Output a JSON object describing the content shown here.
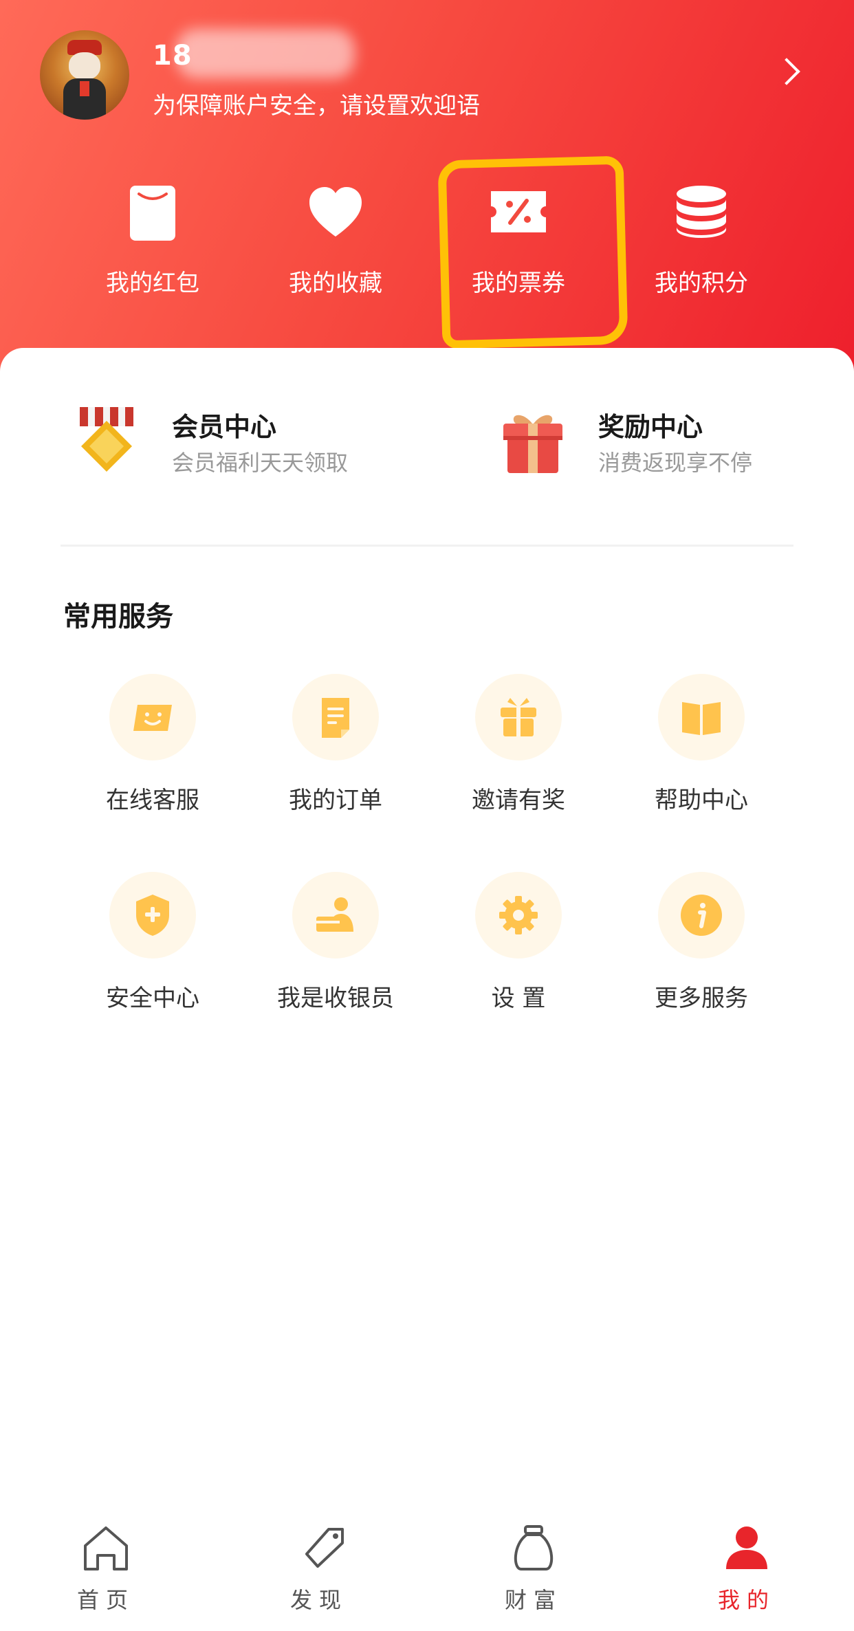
{
  "profile": {
    "phone_visible": "18",
    "greeting": "为保障账户安全，请设置欢迎语"
  },
  "quick_actions": [
    {
      "label": "我的红包",
      "icon": "red-packet-icon"
    },
    {
      "label": "我的收藏",
      "icon": "heart-icon"
    },
    {
      "label": "我的票券",
      "icon": "coupon-icon"
    },
    {
      "label": "我的积分",
      "icon": "coins-stack-icon"
    }
  ],
  "promos": [
    {
      "title": "会员中心",
      "subtitle": "会员福利天天领取",
      "icon": "medal-icon"
    },
    {
      "title": "奖励中心",
      "subtitle": "消费返现享不停",
      "icon": "gift-box-icon"
    }
  ],
  "services": {
    "title": "常用服务",
    "items": [
      {
        "label": "在线客服",
        "icon": "smile-chat-icon"
      },
      {
        "label": "我的订单",
        "icon": "document-icon"
      },
      {
        "label": "邀请有奖",
        "icon": "gift-icon"
      },
      {
        "label": "帮助中心",
        "icon": "book-icon"
      },
      {
        "label": "安全中心",
        "icon": "shield-plus-icon"
      },
      {
        "label": "我是收银员",
        "icon": "cashier-icon"
      },
      {
        "label": "设  置",
        "icon": "gear-icon"
      },
      {
        "label": "更多服务",
        "icon": "info-icon"
      }
    ]
  },
  "tabs": [
    {
      "label": "首页",
      "icon": "home-icon",
      "active": false
    },
    {
      "label": "发现",
      "icon": "tag-icon",
      "active": false
    },
    {
      "label": "财富",
      "icon": "money-bag-icon",
      "active": false
    },
    {
      "label": "我的",
      "icon": "user-icon",
      "active": true
    }
  ],
  "colors": {
    "brand_red": "#ee1f2c",
    "header_light": "#ff6a58",
    "service_icon": "#ffc34d",
    "service_bg": "#fff7e8",
    "highlight_marker": "#ffc107",
    "tab_active": "#e8252b"
  }
}
